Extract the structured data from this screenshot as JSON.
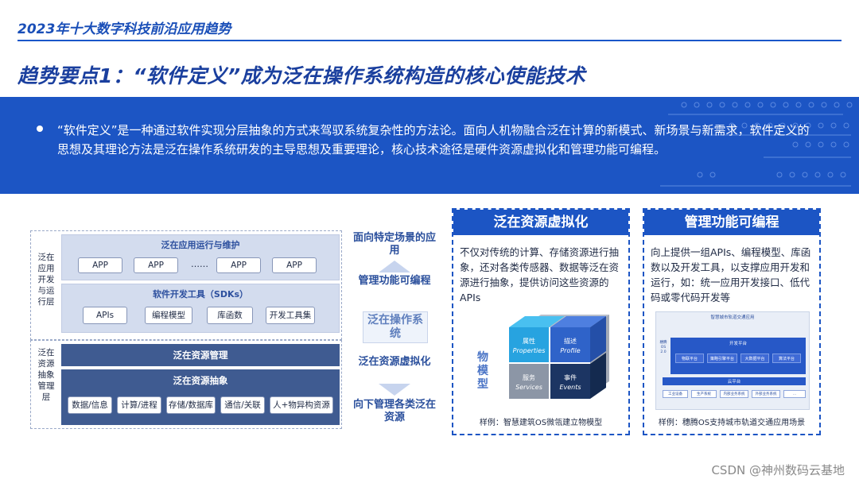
{
  "header": {
    "title": "2023年十大数字科技前沿应用趋势"
  },
  "slide": {
    "title": "趋势要点1：“软件定义”成为泛在操作系统构造的核心使能技术",
    "bullet": "“软件定义”是一种通过软件实现分层抽象的方式来驾驭系统复杂性的方法论。面向人机物融合泛在计算的新模式、新场景与新需求，软件定义的思想及其理论方法是泛在操作系统研发的主导思想及重要理论，核心技术途径是硬件资源虚拟化和管理功能可编程。"
  },
  "diagram": {
    "top_region_label": "泛在应用开发与运行层",
    "bottom_region_label": "泛在资源抽象管理层",
    "app_layer": {
      "title": "泛在应用运行与维护",
      "items": [
        "APP",
        "APP",
        "APP",
        "APP"
      ],
      "ellipsis": "……"
    },
    "sdk_layer": {
      "title": "软件开发工具（SDKs）",
      "items": [
        "APIs",
        "编程模型",
        "库函数",
        "开发工具集"
      ]
    },
    "resource_mgmt": "泛在资源管理",
    "resource_abstract": {
      "title": "泛在资源抽象",
      "items": [
        "数据/信息",
        "计算/进程",
        "存储/数据库",
        "通信/关联",
        "人+物异构资源"
      ]
    }
  },
  "middle": {
    "top_text": "面向特定场景的应用",
    "upper_label": "管理功能可编程",
    "center_box": "泛在操作系统",
    "lower_label": "泛在资源虚拟化",
    "bottom_text": "向下管理各类泛在资源"
  },
  "card_virtualization": {
    "title": "泛在资源虚拟化",
    "body": "不仅对传统的计算、存储资源进行抽象，还对各类传感器、数据等泛在资源进行抽象，提供访问这些资源的APIs",
    "cube_label": "物模型",
    "cubes": [
      {
        "cn": "属性",
        "en": "Properties",
        "color": "#27a3e0"
      },
      {
        "cn": "描述",
        "en": "Profile",
        "color": "#2f63c9"
      },
      {
        "cn": "服务",
        "en": "Services",
        "color": "#8c96a6"
      },
      {
        "cn": "事件",
        "en": "Events",
        "color": "#1c3563"
      }
    ],
    "caption": "样例：智慧建筑OS微瓴建立物模型"
  },
  "card_programmable": {
    "title": "管理功能可编程",
    "body": "向上提供一组APIs、编程模型、库函数以及开发工具，以支撑应用开发和运行，如：统一应用开发接口、低代码或零代码开发等",
    "platform": {
      "title": "智慧城市轨道交通应用",
      "dev_platform": "开发平台",
      "side_label": "穗腾OS 2.0",
      "dev_items": [
        "物联平台",
        "策略引擎平台",
        "大数据平台",
        "算法平台"
      ],
      "cloud_platform": "云平台",
      "systems": [
        "工业设备",
        "生产系统",
        "内部业务系统",
        "外部业务系统",
        "..."
      ]
    },
    "caption": "样例：穗腾OS支持城市轨道交通应用场景"
  },
  "watermark": "CSDN @神州数码云基地",
  "colors": {
    "primary": "#1c55c4",
    "dark_layer": "#3f5b91",
    "light_layer": "#d3dcee"
  }
}
